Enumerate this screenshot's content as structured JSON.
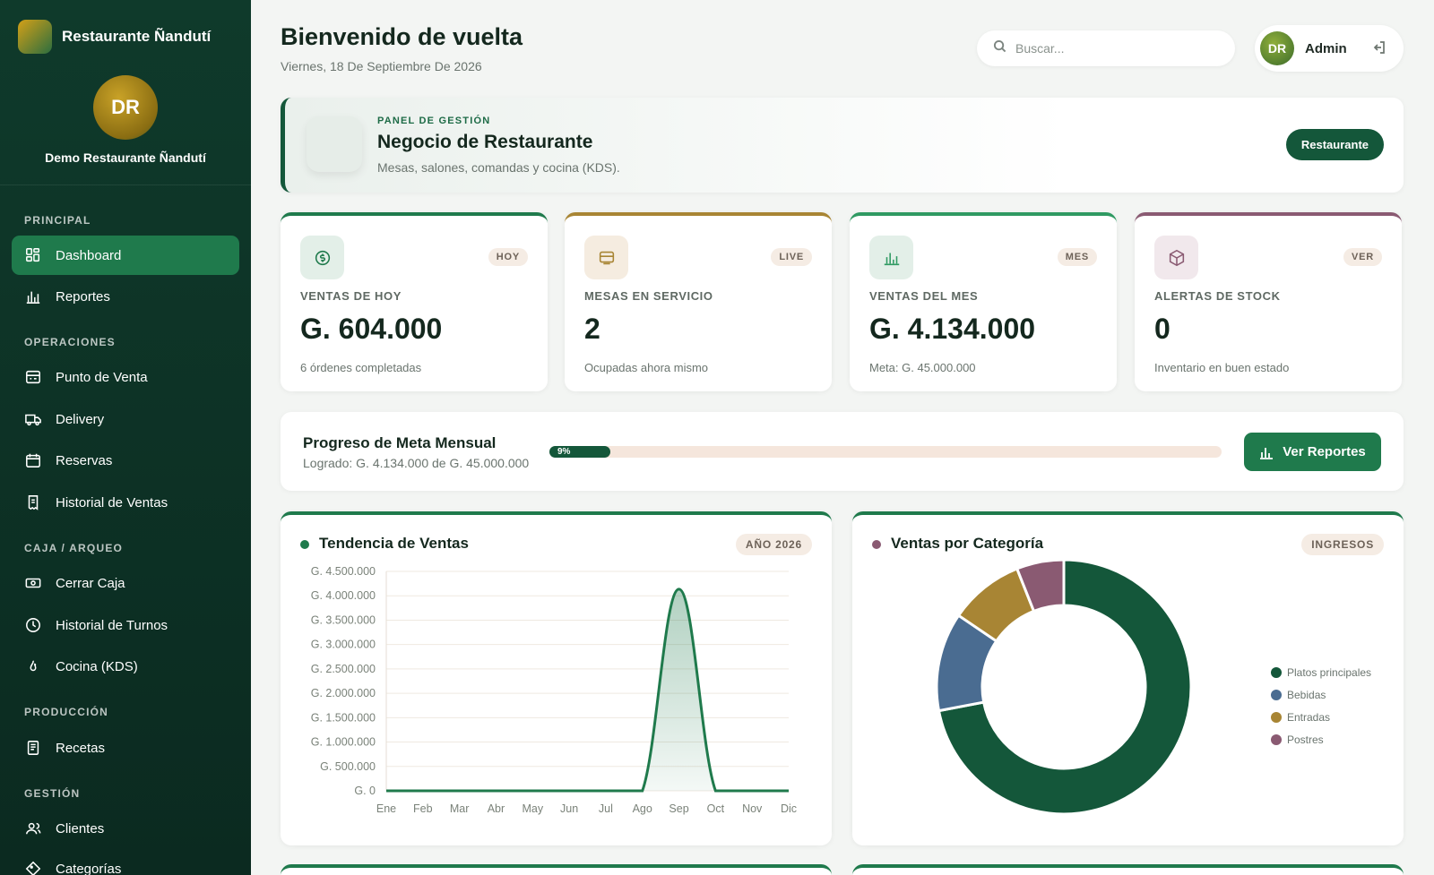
{
  "sidebar": {
    "brand": "Restaurante Ñandutí",
    "avatar_initials": "DR",
    "org_name": "Demo Restaurante Ñandutí",
    "sections": {
      "principal": "PRINCIPAL",
      "operaciones": "OPERACIONES",
      "caja": "CAJA / ARQUEO",
      "produccion": "PRODUCCIÓN",
      "gestion": "GESTIÓN"
    },
    "items": {
      "dashboard": "Dashboard",
      "reportes": "Reportes",
      "punto_venta": "Punto de Venta",
      "delivery": "Delivery",
      "reservas": "Reservas",
      "historial_ventas": "Historial de Ventas",
      "cerrar_caja": "Cerrar Caja",
      "historial_turnos": "Historial de Turnos",
      "cocina": "Cocina (KDS)",
      "recetas": "Recetas",
      "clientes": "Clientes",
      "categorias": "Categorías"
    },
    "icons": {
      "dashboard": "grid-icon",
      "reportes": "bar-chart-icon",
      "punto_venta": "register-icon",
      "delivery": "truck-icon",
      "reservas": "calendar-icon",
      "historial_ventas": "receipt-icon",
      "cerrar_caja": "cash-icon",
      "historial_turnos": "clock-icon",
      "cocina": "flame-icon",
      "recetas": "book-icon",
      "clientes": "users-icon",
      "categorias": "tag-icon"
    }
  },
  "header": {
    "title": "Bienvenido de vuelta",
    "date": "Viernes, 18 De Septiembre De 2026",
    "search_placeholder": "Buscar...",
    "user_initials": "DR",
    "user_name": "Admin"
  },
  "panel": {
    "kicker": "PANEL DE GESTIÓN",
    "title": "Negocio de Restaurante",
    "subtitle": "Mesas, salones, comandas y cocina (KDS).",
    "button": "Restaurante"
  },
  "kpis": [
    {
      "badge": "HOY",
      "label": "VENTAS DE HOY",
      "value": "G. 604.000",
      "sub": "6 órdenes completadas",
      "icon": "coin-icon",
      "accent": "#1f7a4c"
    },
    {
      "badge": "LIVE",
      "label": "MESAS EN SERVICIO",
      "value": "2",
      "sub": "Ocupadas ahora mismo",
      "icon": "table-icon",
      "accent": "#a88534"
    },
    {
      "badge": "MES",
      "label": "VENTAS DEL MES",
      "value": "G. 4.134.000",
      "sub": "Meta: G. 45.000.000",
      "icon": "bar-chart-icon",
      "accent": "#2f9a62"
    },
    {
      "badge": "VER",
      "label": "ALERTAS DE STOCK",
      "value": "0",
      "sub": "Inventario en buen estado",
      "icon": "box-icon",
      "accent": "#8a5a72"
    }
  ],
  "progress": {
    "title": "Progreso de Meta Mensual",
    "subtitle": "Logrado: G. 4.134.000 de G. 45.000.000",
    "percent_label": "9%",
    "percent": 9,
    "button": "Ver Reportes"
  },
  "colors": {
    "primary": "#14573a",
    "accent_green": "#1f7a4c",
    "gold": "#a88534",
    "mauve": "#8a5a72"
  },
  "chart_data": [
    {
      "type": "area",
      "title": "Tendencia de Ventas",
      "badge": "AÑO 2026",
      "categories": [
        "Ene",
        "Feb",
        "Mar",
        "Abr",
        "May",
        "Jun",
        "Jul",
        "Ago",
        "Sep",
        "Oct",
        "Nov",
        "Dic"
      ],
      "values": [
        0,
        0,
        0,
        0,
        0,
        0,
        0,
        0,
        4134000,
        0,
        0,
        0
      ],
      "yticks": [
        "G. 0",
        "G. 500.000",
        "G. 1.000.000",
        "G. 1.500.000",
        "G. 2.000.000",
        "G. 2.500.000",
        "G. 3.000.000",
        "G. 3.500.000",
        "G. 4.000.000",
        "G. 4.500.000"
      ],
      "ylim": [
        0,
        4500000
      ],
      "grid": true,
      "color": "#1f7a4c"
    },
    {
      "type": "pie",
      "title": "Ventas por Categoría",
      "badge": "INGRESOS",
      "categories": [
        "Platos principales",
        "Bebidas",
        "Entradas",
        "Postres"
      ],
      "values": [
        72,
        12.5,
        9.5,
        6
      ],
      "colors": [
        "#14573a",
        "#4a6c91",
        "#a88534",
        "#8a5a72"
      ],
      "legend": "right"
    }
  ]
}
